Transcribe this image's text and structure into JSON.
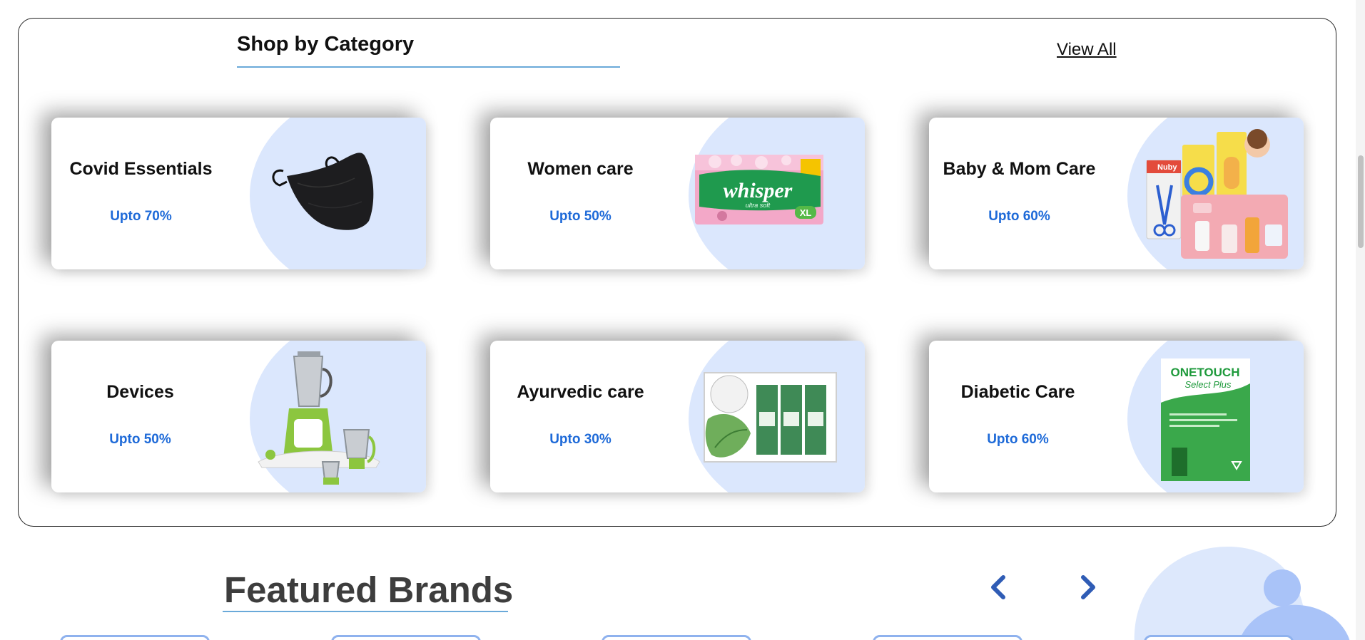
{
  "shop_by_category": {
    "title": "Shop by Category",
    "view_all_label": "View All",
    "categories": [
      {
        "name": "Covid Essentials",
        "offer": "Upto 70%",
        "icon": "face-mask-icon"
      },
      {
        "name": "Women care",
        "offer": "Upto 50%",
        "icon": "sanitary-pad-pack-icon",
        "product_text": "whisper",
        "product_subtext": "ultra soft",
        "product_size": "XL"
      },
      {
        "name": "Baby & Mom Care",
        "offer": "Upto 60%",
        "icon": "baby-care-kit-icon",
        "product_text": "Nuby"
      },
      {
        "name": "Devices",
        "offer": "Upto 50%",
        "icon": "mixer-grinder-icon"
      },
      {
        "name": "Ayurvedic care",
        "offer": "Upto 30%",
        "icon": "ayurvedic-gift-box-icon"
      },
      {
        "name": "Diabetic Care",
        "offer": "Upto 60%",
        "icon": "glucose-test-strips-icon",
        "product_text": "ONETOUCH",
        "product_subtext": "Select Plus"
      }
    ]
  },
  "featured_brands": {
    "title": "Featured Brands",
    "prev_icon": "chevron-left-icon",
    "next_icon": "chevron-right-icon"
  },
  "colors": {
    "accent_blue": "#1e6ad8",
    "blob_blue": "#dbe7fd",
    "underline_blue": "#6aa9d9",
    "arrow_blue": "#2f5cb5"
  }
}
